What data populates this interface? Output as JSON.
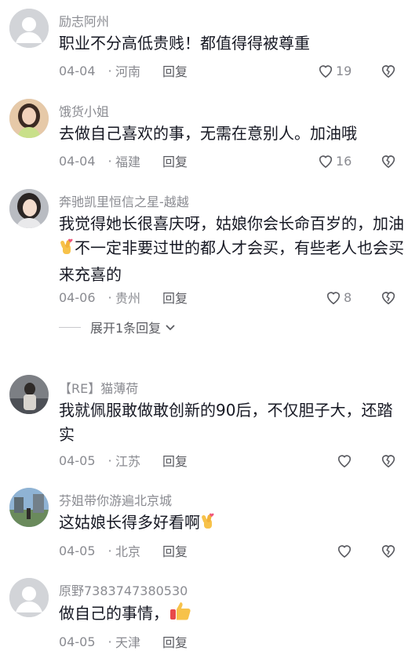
{
  "comments": [
    {
      "user": "励志阿州",
      "text": "职业不分高低贵贱！都值得得被尊重",
      "date": "04-04",
      "location": "河南",
      "reply_label": "回复",
      "likes": "19"
    },
    {
      "user": "饿货小姐",
      "text": "去做自己喜欢的事，无需在意别人。加油哦",
      "date": "04-04",
      "location": "福建",
      "reply_label": "回复",
      "likes": "16"
    },
    {
      "user": "奔驰凯里恒信之星-越越",
      "text_a": "我觉得她长很喜庆呀，姑娘你会长命百岁的，加油",
      "text_b": "不一定非要过世的都人才会买，有些老人也会买来充喜的",
      "date": "04-06",
      "location": "贵州",
      "reply_label": "回复",
      "likes": "8"
    },
    {
      "user": "【RE】猫薄荷",
      "text": "我就佩服敢做敢创新的90后，不仅胆子大，还踏实",
      "date": "04-05",
      "location": "江苏",
      "reply_label": "回复",
      "likes": ""
    },
    {
      "user": "芬姐带你游遍北京城",
      "text": "这姑娘长得多好看啊",
      "date": "04-05",
      "location": "北京",
      "reply_label": "回复",
      "likes": ""
    },
    {
      "user": "原野7383747380530",
      "text": "做自己的事情，",
      "date": "04-05",
      "location": "天津",
      "reply_label": "回复",
      "likes": ""
    }
  ],
  "expand_replies": "展开1条回复",
  "icons": {
    "like": "heart-outline-icon",
    "dislike": "broken-heart-icon",
    "expand": "chevron-down-icon",
    "fingers": "finger-heart-emoji",
    "thumbs": "thumbs-up-emoji"
  }
}
